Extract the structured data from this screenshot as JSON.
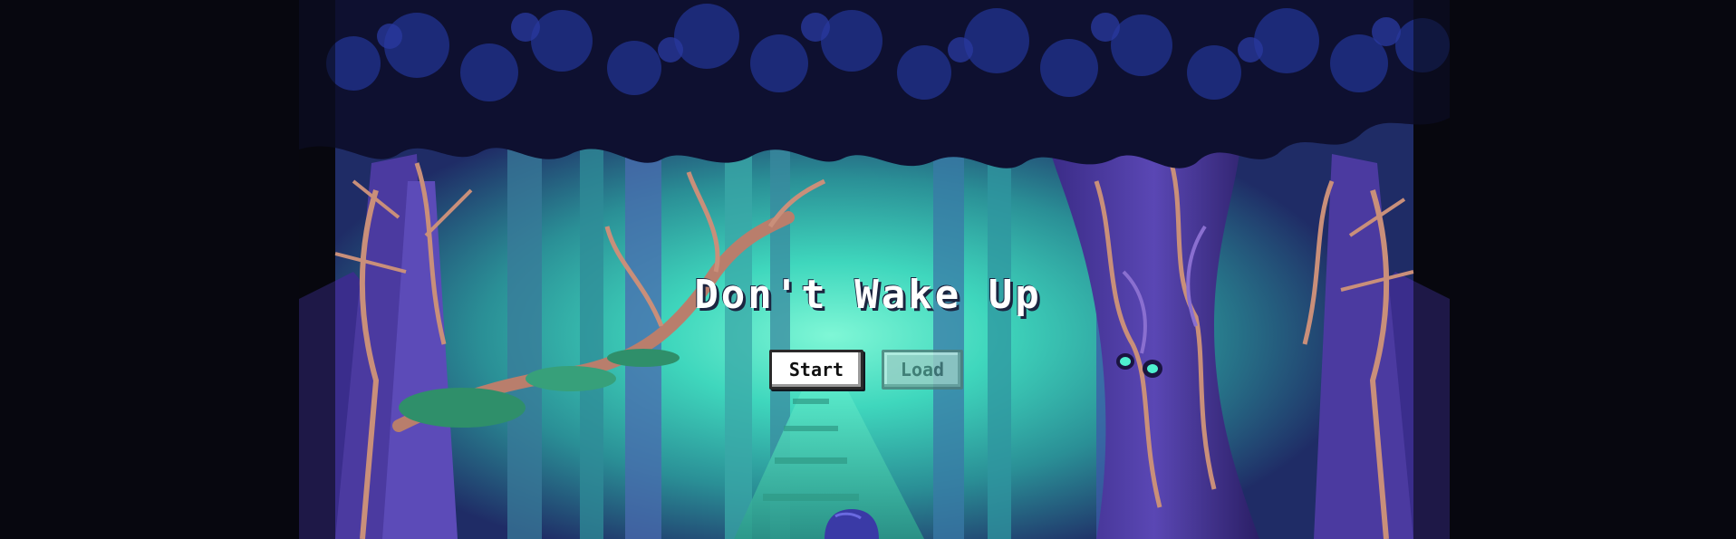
{
  "game": {
    "title": "Don't Wake Up"
  },
  "menu": {
    "start_label": "Start",
    "load_label": "Load",
    "load_enabled": false
  },
  "palette": {
    "background": "#07070f",
    "canopy": "#1c2a78",
    "glow": "#3fe8c4",
    "tree_violet": "#4b3aa0",
    "branch_tan": "#c98f7a",
    "moss": "#2f8f6a",
    "eye": "#4ff0d0"
  },
  "icons": {
    "background_art": "forest-scene",
    "tree_face": "tree-face",
    "cloaked_figure": "cloaked-figure"
  }
}
